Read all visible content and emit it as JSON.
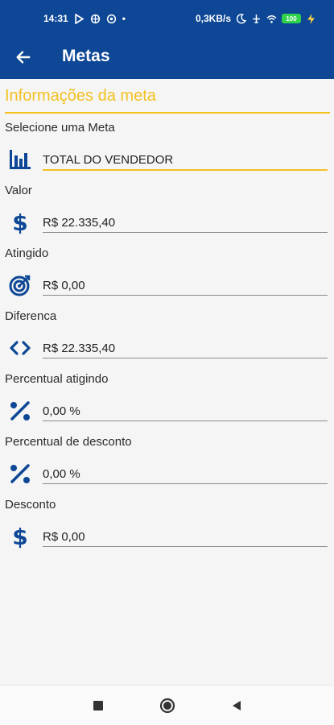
{
  "status_bar": {
    "time": "14:31",
    "network_speed": "0,3KB/s",
    "battery_level": "100"
  },
  "app_bar": {
    "title": "Metas",
    "back_icon": "arrow-left-icon"
  },
  "section": {
    "title": "Informações da meta"
  },
  "fields": [
    {
      "label": "Selecione uma Meta",
      "value": "TOTAL DO VENDEDOR",
      "icon": "bar-chart-icon"
    },
    {
      "label": "Valor",
      "value": "R$ 22.335,40",
      "icon": "dollar-icon"
    },
    {
      "label": "Atingido",
      "value": "R$ 0,00",
      "icon": "target-icon"
    },
    {
      "label": "Diferenca",
      "value": "R$ 22.335,40",
      "icon": "code-brackets-icon"
    },
    {
      "label": "Percentual atigindo",
      "value": "0,00 %",
      "icon": "percent-icon"
    },
    {
      "label": "Percentual de desconto",
      "value": "0,00 %",
      "icon": "percent-icon"
    },
    {
      "label": "Desconto",
      "value": "R$ 0,00",
      "icon": "dollar-icon"
    }
  ],
  "nav_bar": {
    "recents_icon": "square-icon",
    "home_icon": "circle-icon",
    "back_icon": "triangle-back-icon"
  },
  "colors": {
    "primary": "#0d4795",
    "accent": "#f4c122",
    "background": "#f5f5f5"
  }
}
